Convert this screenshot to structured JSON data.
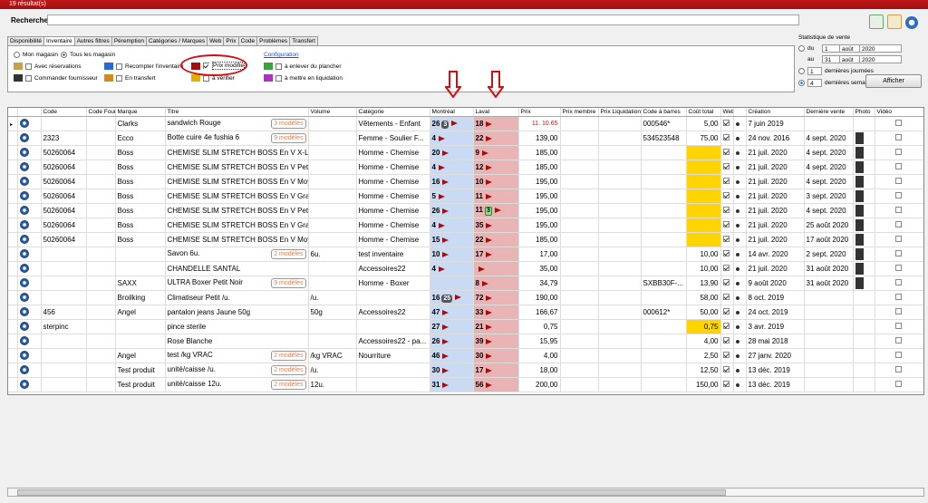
{
  "window": {
    "title": "19 résultat(s)"
  },
  "search": {
    "label": "Recherche:",
    "value": ""
  },
  "tabs": [
    "Disponibilité",
    "Inventaire",
    "Autres filtres",
    "Péremption",
    "Catégories / Marques",
    "Web",
    "Prix",
    "Code",
    "Problèmes",
    "Transfert"
  ],
  "filters": {
    "mon_magasin": "Mon magasin",
    "tous_magasins": "Tous les magasin",
    "avec_reservations": "Avec réservations",
    "commander_fournisseur": "Commander fournisseur",
    "recompter_inventaire": "Recompter l'inventaire",
    "en_transfert": "En transfert",
    "prix_modifie": "Prix modifié",
    "a_verifier": "à vérifier",
    "configuration": "Configuration",
    "enlever_plancher": "à enlever du plancher",
    "mettre_liquidation": "à mettre en liquidation"
  },
  "stats": {
    "title": "Statistique de vente",
    "du": "du",
    "au": "au",
    "du_day": "1",
    "du_month": "août",
    "du_year": "2020",
    "au_day": "31",
    "au_month": "août",
    "au_year": "2020",
    "jours_value": "1",
    "jours_label": "dernières journées",
    "semaines_value": "4",
    "semaines_label": "dernières semaines",
    "afficher": "Afficher"
  },
  "columns": [
    "Code",
    "Code Four.",
    "Marque",
    "Titre",
    "Volume",
    "Catégorie",
    "Montréal",
    "Laval",
    "Prix",
    "Prix membre",
    "Prix Liquidation",
    "Code à barres",
    "Coût total",
    "Web",
    "",
    "Création",
    "Dernière vente",
    "Photo",
    "Vidéo"
  ],
  "rows": [
    {
      "code": "",
      "four": "",
      "marque": "Clarks",
      "titre": "sandwich Rouge",
      "mod": "3 modèles",
      "volume": "",
      "cat": "Vêtements - Enfant",
      "mtl": "26",
      "mtl_badge": "3",
      "lvl": "18",
      "prix": "11. 10.65",
      "barcode": "000546*",
      "cout": "5,00",
      "yel": false,
      "web": true,
      "creation": "7 juin 2019",
      "derniere": "",
      "photo": false
    },
    {
      "code": "2323",
      "four": "",
      "marque": "Ecco",
      "titre": "Botte cuire 4e fushia 6",
      "mod": "9 modèles",
      "volume": "",
      "cat": "Femme - Soulier F...",
      "mtl": "4",
      "mtl_badge": "",
      "lvl": "22",
      "prix": "139,00",
      "barcode": "534523548",
      "cout": "75,00",
      "yel": false,
      "web": true,
      "creation": "24 nov. 2016",
      "derniere": "4 sept. 2020",
      "photo": true
    },
    {
      "code": "50260064",
      "four": "",
      "marque": "Boss",
      "titre": "CHEMISE SLIM STRETCH BOSS En V X-Larg",
      "mod": "",
      "volume": "",
      "cat": "Homme - Chemise",
      "mtl": "20",
      "mtl_badge": "",
      "lvl": "9",
      "prix": "185,00",
      "barcode": "",
      "cout": "",
      "yel": true,
      "web": true,
      "creation": "21 juil. 2020",
      "derniere": "4 sept. 2020",
      "photo": true
    },
    {
      "code": "50260064",
      "four": "",
      "marque": "Boss",
      "titre": "CHEMISE SLIM STRETCH BOSS En V Petit M",
      "mod": "",
      "volume": "",
      "cat": "Homme - Chemise",
      "mtl": "4",
      "mtl_badge": "",
      "lvl": "12",
      "prix": "185,00",
      "barcode": "",
      "cout": "",
      "yel": true,
      "web": true,
      "creation": "21 juil. 2020",
      "derniere": "4 sept. 2020",
      "photo": true
    },
    {
      "code": "50260064",
      "four": "",
      "marque": "Boss",
      "titre": "CHEMISE SLIM STRETCH BOSS En V Moyen",
      "mod": "",
      "volume": "",
      "cat": "Homme - Chemise",
      "mtl": "16",
      "mtl_badge": "",
      "lvl": "10",
      "prix": "195,00",
      "barcode": "",
      "cout": "",
      "yel": true,
      "web": true,
      "creation": "21 juil. 2020",
      "derniere": "4 sept. 2020",
      "photo": true
    },
    {
      "code": "50260064",
      "four": "",
      "marque": "Boss",
      "titre": "CHEMISE SLIM STRETCH BOSS En V Grand",
      "mod": "",
      "volume": "",
      "cat": "Homme - Chemise",
      "mtl": "5",
      "mtl_badge": "",
      "lvl": "11",
      "prix": "195,00",
      "barcode": "",
      "cout": "",
      "yel": true,
      "web": true,
      "creation": "21 juil. 2020",
      "derniere": "3 sept. 2020",
      "photo": true
    },
    {
      "code": "50260064",
      "four": "",
      "marque": "Boss",
      "titre": "CHEMISE SLIM STRETCH BOSS En V Petit B",
      "mod": "",
      "volume": "",
      "cat": "Homme - Chemise",
      "mtl": "26",
      "mtl_badge": "",
      "lvl": "11",
      "lvl_badge": "3",
      "prix": "195,00",
      "barcode": "",
      "cout": "",
      "yel": true,
      "web": true,
      "creation": "21 juil. 2020",
      "derniere": "4 sept. 2020",
      "photo": true
    },
    {
      "code": "50260064",
      "four": "",
      "marque": "Boss",
      "titre": "CHEMISE SLIM STRETCH BOSS En V Grand",
      "mod": "",
      "volume": "",
      "cat": "Homme - Chemise",
      "mtl": "4",
      "mtl_badge": "",
      "lvl": "35",
      "prix": "195,00",
      "barcode": "",
      "cout": "",
      "yel": true,
      "web": true,
      "creation": "21 juil. 2020",
      "derniere": "25 août 2020",
      "photo": true
    },
    {
      "code": "50260064",
      "four": "",
      "marque": "Boss",
      "titre": "CHEMISE SLIM STRETCH BOSS En V Moyer",
      "mod": "",
      "volume": "",
      "cat": "Homme - Chemise",
      "mtl": "15",
      "mtl_badge": "",
      "lvl": "22",
      "prix": "185,00",
      "barcode": "",
      "cout": "",
      "yel": true,
      "web": true,
      "creation": "21 juil. 2020",
      "derniere": "17 août 2020",
      "photo": true
    },
    {
      "code": "",
      "four": "",
      "marque": "",
      "titre": "Savon 6u.",
      "mod": "2 modèles",
      "volume": "6u.",
      "cat": "test inventaire",
      "mtl": "10",
      "mtl_badge": "",
      "lvl": "17",
      "prix": "17,00",
      "barcode": "",
      "cout": "10,00",
      "yel": false,
      "web": true,
      "creation": "14 avr. 2020",
      "derniere": "2 sept. 2020",
      "photo": true
    },
    {
      "code": "",
      "four": "",
      "marque": "",
      "titre": "CHANDELLE SANTAL",
      "mod": "",
      "volume": "",
      "cat": "Accessoires22",
      "mtl": "4",
      "mtl_badge": "",
      "lvl": "",
      "prix": "35,00",
      "barcode": "",
      "cout": "10,00",
      "yel": false,
      "web": true,
      "creation": "21 juil. 2020",
      "derniere": "31 août 2020",
      "photo": true
    },
    {
      "code": "",
      "four": "",
      "marque": "SAXX",
      "titre": "ULTRA Boxer Petit Noir",
      "mod": "9 modèles",
      "volume": "",
      "cat": "Homme - Boxer",
      "mtl": "",
      "mtl_badge": "",
      "lvl": "8",
      "prix": "34,79",
      "barcode": "SXBB30F-...",
      "cout": "13,90",
      "yel": false,
      "web": true,
      "creation": "9 août 2020",
      "derniere": "31 août 2020",
      "photo": true
    },
    {
      "code": "",
      "four": "",
      "marque": "Broilking",
      "titre": "Climatiseur Petit /u.",
      "mod": "",
      "volume": "/u.",
      "cat": "",
      "mtl": "16",
      "mtl_badge": "25",
      "lvl": "72",
      "prix": "190,00",
      "barcode": "",
      "cout": "58,00",
      "yel": false,
      "web": true,
      "creation": "8 oct. 2019",
      "derniere": "",
      "photo": false
    },
    {
      "code": "456",
      "four": "",
      "marque": "Angel",
      "titre": "pantalon jeans Jaune 50g",
      "mod": "",
      "volume": "50g",
      "cat": "Accessoires22",
      "mtl": "47",
      "mtl_badge": "",
      "lvl": "33",
      "prix": "166,67",
      "barcode": "000612*",
      "cout": "50,00",
      "yel": false,
      "web": true,
      "creation": "24 oct. 2019",
      "derniere": "",
      "photo": false
    },
    {
      "code": "sterpinc",
      "four": "",
      "marque": "",
      "titre": "pince sterile",
      "mod": "",
      "volume": "",
      "cat": "",
      "mtl": "27",
      "mtl_badge": "",
      "lvl": "21",
      "prix": "0,75",
      "barcode": "",
      "cout": "0,75",
      "yel": true,
      "web": true,
      "creation": "3 avr. 2019",
      "derniere": "",
      "photo": false
    },
    {
      "code": "",
      "four": "",
      "marque": "",
      "titre": "Rose Blanche",
      "mod": "",
      "volume": "",
      "cat": "Accessoires22 - pa...",
      "mtl": "26",
      "mtl_badge": "",
      "lvl": "39",
      "prix": "15,95",
      "barcode": "",
      "cout": "4,00",
      "yel": false,
      "web": true,
      "creation": "28 mai 2018",
      "derniere": "",
      "photo": false
    },
    {
      "code": "",
      "four": "",
      "marque": "Angel",
      "titre": "test /kg VRAC",
      "mod": "2 modèles",
      "volume": "/kg VRAC",
      "cat": "Nourriture",
      "mtl": "46",
      "mtl_badge": "",
      "lvl": "30",
      "prix": "4,00",
      "barcode": "",
      "cout": "2,50",
      "yel": false,
      "web": true,
      "creation": "27 janv. 2020",
      "derniere": "",
      "photo": false
    },
    {
      "code": "",
      "four": "",
      "marque": "Test produit",
      "titre": "unité/caisse /u.",
      "mod": "2 modèles",
      "volume": "/u.",
      "cat": "",
      "mtl": "30",
      "mtl_badge": "",
      "lvl": "17",
      "prix": "18,00",
      "barcode": "",
      "cout": "12,50",
      "yel": false,
      "web": true,
      "creation": "13 déc. 2019",
      "derniere": "",
      "photo": false
    },
    {
      "code": "",
      "four": "",
      "marque": "Test produit",
      "titre": "unité/caisse 12u.",
      "mod": "2 modèles",
      "volume": "12u.",
      "cat": "",
      "mtl": "31",
      "mtl_badge": "",
      "lvl": "56",
      "prix": "200,00",
      "barcode": "",
      "cout": "150,00",
      "yel": false,
      "web": true,
      "creation": "13 déc. 2019",
      "derniere": "",
      "photo": false
    }
  ]
}
